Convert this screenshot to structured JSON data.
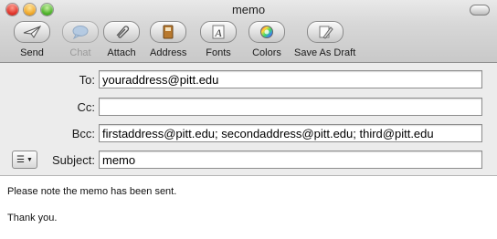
{
  "window": {
    "title": "memo"
  },
  "toolbar": {
    "items": [
      {
        "label": "Send",
        "icon": "send-icon"
      },
      {
        "label": "Chat",
        "icon": "chat-icon",
        "disabled": true
      },
      {
        "label": "Attach",
        "icon": "paperclip-icon"
      },
      {
        "label": "Address",
        "icon": "address-book-icon"
      },
      {
        "label": "Fonts",
        "icon": "fonts-icon"
      },
      {
        "label": "Colors",
        "icon": "color-wheel-icon"
      },
      {
        "label": "Save As Draft",
        "icon": "save-draft-icon"
      }
    ]
  },
  "header": {
    "to": {
      "label": "To:",
      "value": "youraddress@pitt.edu"
    },
    "cc": {
      "label": "Cc:",
      "value": ""
    },
    "bcc": {
      "label": "Bcc:",
      "value": "firstaddress@pitt.edu; secondaddress@pitt.edu; third@pitt.edu"
    },
    "subject": {
      "label": "Subject:",
      "value": "memo"
    }
  },
  "message": {
    "lines": [
      "Please note the memo has been sent.",
      "Thank you."
    ]
  }
}
